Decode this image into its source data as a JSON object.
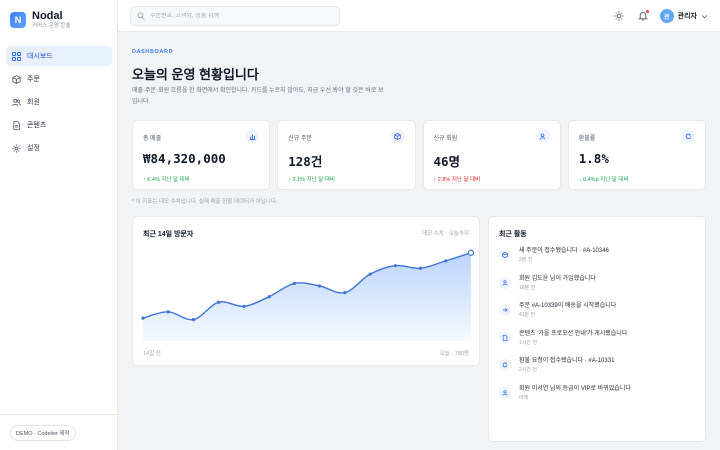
{
  "brand": {
    "logo_letter": "N",
    "name": "Nodal",
    "subtitle": "커머스 운영 콘솔"
  },
  "sidebar": {
    "items": [
      {
        "label": "대시보드",
        "icon": "grid-icon",
        "active": true
      },
      {
        "label": "주문",
        "icon": "box-icon",
        "active": false
      },
      {
        "label": "회원",
        "icon": "users-icon",
        "active": false
      },
      {
        "label": "콘텐츠",
        "icon": "document-icon",
        "active": false
      },
      {
        "label": "설정",
        "icon": "gear-icon",
        "active": false
      }
    ],
    "footer_badge": "DEMO · Codelier 제작"
  },
  "header": {
    "search_placeholder": "주문번호, 고객명, 상품 검색",
    "user": {
      "avatar_letter": "관",
      "name": "관리자"
    },
    "icons": [
      "sun-icon",
      "bell-icon",
      "chevron-down-icon"
    ]
  },
  "main": {
    "eyebrow": "DASHBOARD",
    "title": "오늘의 운영 현황입니다",
    "description": "매출·주문·회원 흐름을 한 화면에서 확인합니다. 카드를 누르지 않아도, 지금 우선 봐야 할 것은 이렇게 정리됩니다.",
    "description_visible": "매출·주문·회원 흐름을 한 화면에서 확인합니다. 카드를 누르지 않아도, 지금 우선 봐야 할 것은 바로 보입니다.",
    "kpis": [
      {
        "label": "총 매출",
        "value": "₩84,320,000",
        "delta": "↑ 6.4% 지난 달 대비",
        "trend": "up",
        "icon": "bar-chart-icon"
      },
      {
        "label": "신규 주문",
        "value": "128건",
        "delta": "↑ 3.1% 지난 달 대비",
        "trend": "up",
        "icon": "box-icon"
      },
      {
        "label": "신규 회원",
        "value": "46명",
        "delta": "↓ 2.8% 지난 달 대비",
        "trend": "down",
        "icon": "user-icon"
      },
      {
        "label": "환불률",
        "value": "1.8%",
        "delta": "↓ 0.4%p 지난 달 대비",
        "trend": "up",
        "icon": "refresh-icon"
      }
    ],
    "footnote": "* 이 지표는 데모 수치입니다. 실제 매출 현황 데이터가 아닙니다."
  },
  "visitor_chart": {
    "title": "최근 14일 방문자",
    "meta": "데모 수치 · 오늘까지",
    "axis_left": "14일 전",
    "axis_right": "오늘 · 780명"
  },
  "chart_data": {
    "type": "area",
    "title": "최근 14일 방문자",
    "x": [
      1,
      2,
      3,
      4,
      5,
      6,
      7,
      8,
      9,
      10,
      11,
      12,
      13,
      14
    ],
    "values": [
      310,
      395,
      290,
      525,
      470,
      600,
      780,
      745,
      655,
      905,
      1020,
      985,
      1085,
      1195
    ],
    "highlight_last": true
  },
  "activity": {
    "title": "최근 활동",
    "items": [
      {
        "text": "새 주문이 접수됐습니다 · #A-10346",
        "time": "2분 전",
        "icon": "box-icon"
      },
      {
        "text": "회원 김도윤 님이 가입했습니다",
        "time": "18분 전",
        "icon": "user-icon"
      },
      {
        "text": "주문 #A-10339이 배송을 시작했습니다",
        "time": "41분 전",
        "icon": "arrow-right-icon"
      },
      {
        "text": "콘텐츠 '가을 프로모션 안내'가 게시됐습니다",
        "time": "1시간 전",
        "icon": "document-icon"
      },
      {
        "text": "환불 요청이 접수됐습니다 · #A-10331",
        "time": "2시간 전",
        "icon": "refresh-icon"
      },
      {
        "text": "회원 이서연 님의 등급이 VIP로 바뀌었습니다",
        "time": "어제",
        "icon": "user-icon"
      }
    ]
  },
  "colors": {
    "accent": "#3b82f6",
    "up": "#16a34a",
    "down": "#dc2626"
  }
}
